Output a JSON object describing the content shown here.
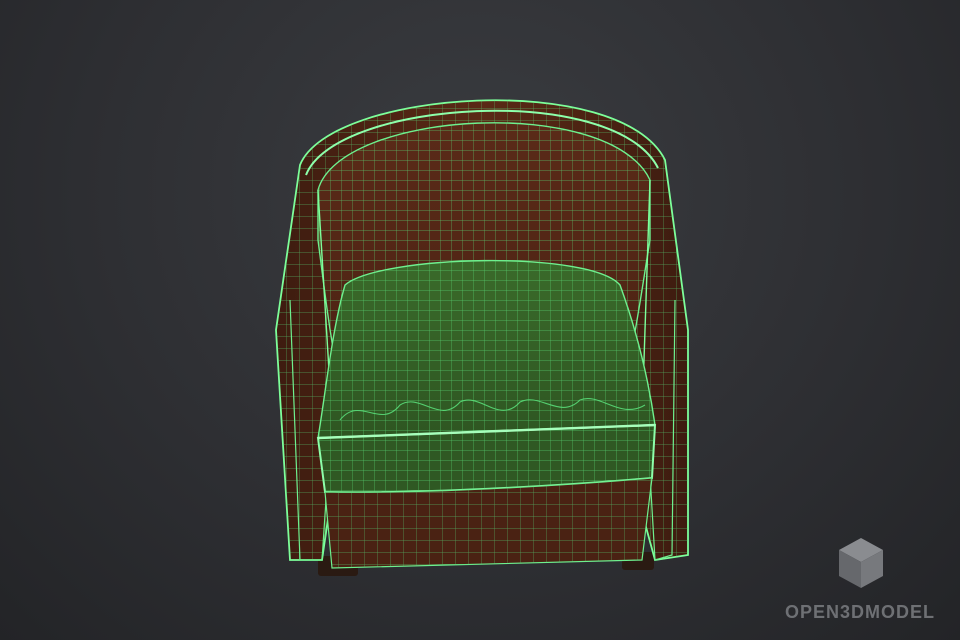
{
  "scene": {
    "subject": "armchair-wireframe",
    "colors": {
      "background": "#2e2f33",
      "shell": "#4e2414",
      "shell_dark": "#3a1a0e",
      "cushion": "#3c6a28",
      "cushion_dark": "#2c5020",
      "wire": "#59e07a",
      "wire_edge": "#7dff9a",
      "legs": "#2a1a12"
    }
  },
  "watermark": {
    "text": "OPEN3DMODEL",
    "icon": "cube-icon",
    "color": "#6e7074"
  }
}
